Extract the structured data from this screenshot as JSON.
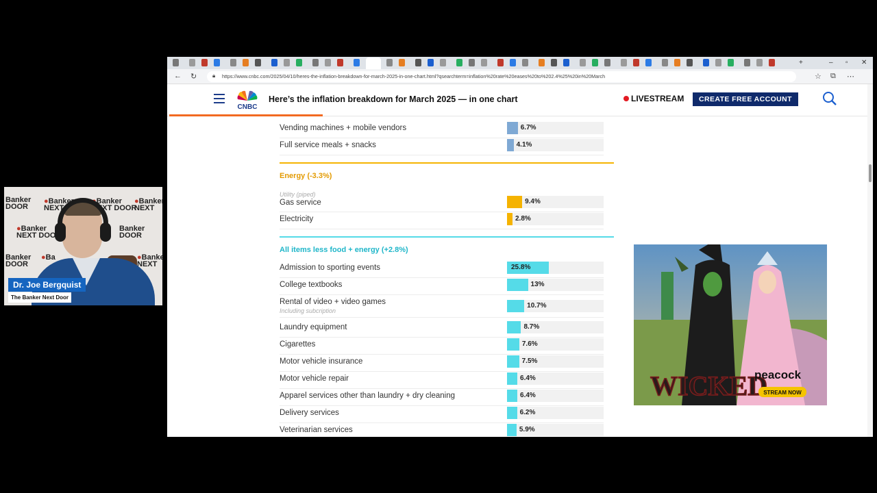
{
  "webcam": {
    "name": "Dr. Joe Bergquist",
    "subtitle": "The Banker Next Door",
    "watermark": "The Banker NEXT DOOR"
  },
  "browser": {
    "url": "https://www.cnbc.com/2025/04/10/heres-the-inflation-breakdown-for-march-2025-in-one-chart.html?qsearchterm=inflation%20rate%20eases%20to%202.4%25%20in%20March"
  },
  "header": {
    "logo": "CNBC",
    "headline": "Here’s the inflation breakdown for March 2025 — in one chart",
    "livestream": "LIVESTREAM",
    "cta": "CREATE FREE ACCOUNT"
  },
  "colors": {
    "food": "#7fa9d4",
    "energy": "#f5b301",
    "core": "#55dbe8",
    "energy_title": "#e39a00",
    "core_title": "#1fb6c9",
    "progress": "#f26a21",
    "cta_bg": "#0f2a6b"
  },
  "top_rows": [
    {
      "label": "Vending machines + mobile vendors",
      "value": 6.7,
      "value_label": "6.7%"
    },
    {
      "label": "Full service meals + snacks",
      "value": 4.1,
      "value_label": "4.1%"
    }
  ],
  "energy": {
    "title": "Energy (-3.3%)",
    "rows": [
      {
        "label": "Gas service",
        "sublabel": "Utility (piped)",
        "value": 9.4,
        "value_label": "9.4%"
      },
      {
        "label": "Electricity",
        "value": 2.8,
        "value_label": "2.8%"
      }
    ]
  },
  "core": {
    "title": "All items less food + energy (+2.8%)",
    "rows": [
      {
        "label": "Admission to sporting events",
        "value": 25.8,
        "value_label": "25.8%"
      },
      {
        "label": "College textbooks",
        "value": 13,
        "value_label": "13%"
      },
      {
        "label": "Rental of video + video games",
        "sublabel": "Including subcription",
        "value": 10.7,
        "value_label": "10.7%"
      },
      {
        "label": "Laundry equipment",
        "value": 8.7,
        "value_label": "8.7%"
      },
      {
        "label": "Cigarettes",
        "value": 7.6,
        "value_label": "7.6%"
      },
      {
        "label": "Motor vehicle insurance",
        "value": 7.5,
        "value_label": "7.5%"
      },
      {
        "label": "Motor vehicle repair",
        "value": 6.4,
        "value_label": "6.4%"
      },
      {
        "label": "Apparel services other than laundry + dry cleaning",
        "value": 6.4,
        "value_label": "6.4%"
      },
      {
        "label": "Delivery services",
        "value": 6.2,
        "value_label": "6.2%"
      },
      {
        "label": "Veterinarian services",
        "value": 5.9,
        "value_label": "5.9%"
      }
    ]
  },
  "chart_data": {
    "type": "bar",
    "max_value": 60,
    "series": [
      {
        "name": "Energy (-3.3%)",
        "categories": [
          "Gas service",
          "Electricity"
        ],
        "values": [
          9.4,
          2.8
        ]
      },
      {
        "name": "All items less food + energy (+2.8%)",
        "categories": [
          "Admission to sporting events",
          "College textbooks",
          "Rental of video + video games",
          "Laundry equipment",
          "Cigarettes",
          "Motor vehicle insurance",
          "Motor vehicle repair",
          "Apparel services other than laundry + dry cleaning",
          "Delivery services",
          "Veterinarian services"
        ],
        "values": [
          25.8,
          13,
          10.7,
          8.7,
          7.6,
          7.5,
          6.4,
          6.4,
          6.2,
          5.9
        ]
      }
    ]
  },
  "ad": {
    "title": "WICKED",
    "brand": "peacock",
    "cta": "STREAM NOW"
  }
}
